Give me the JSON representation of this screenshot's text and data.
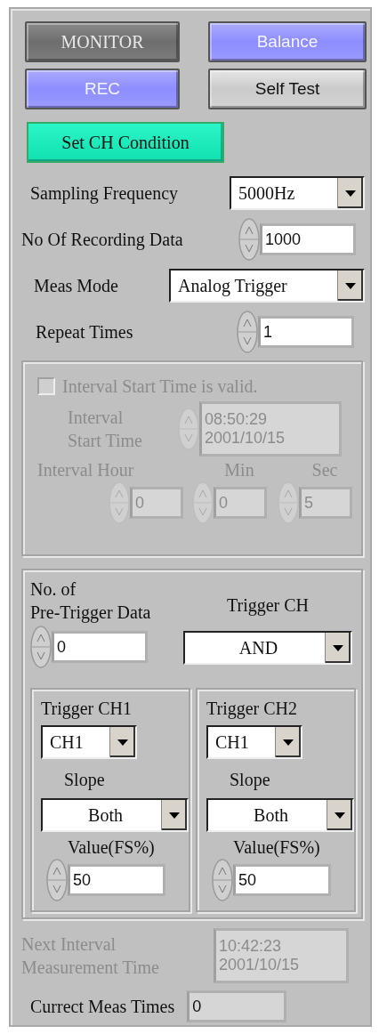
{
  "buttons": [
    {
      "label": "MONITOR",
      "kind": "dark"
    },
    {
      "label": "Balance",
      "kind": "blue"
    },
    {
      "label": "REC",
      "kind": "blue"
    },
    {
      "label": "Self Test",
      "kind": "light"
    }
  ],
  "set_ch_condition": {
    "label": "Set CH Condition"
  },
  "settings": [
    {
      "kind": "dropdown",
      "label": "Sampling Frequency",
      "value": "5000Hz"
    },
    {
      "kind": "spinner",
      "label": "No Of Recording Data",
      "value": "1000"
    },
    {
      "kind": "dropdown",
      "label": "Meas Mode",
      "value": "Analog Trigger"
    },
    {
      "kind": "spinner",
      "label": "Repeat Times",
      "value": "1"
    }
  ],
  "interval": {
    "disabled": true,
    "checkbox": {
      "label": "Interval Start Time is valid.",
      "checked": false
    },
    "start_time": {
      "label": "Interval\nStart Time",
      "value": "08:50:29\n2001/10/15"
    },
    "fields": [
      {
        "label": "Interval Hour",
        "value": "0"
      },
      {
        "label": "Min",
        "value": "0"
      },
      {
        "label": "Sec",
        "value": "5"
      }
    ]
  },
  "trigger": {
    "pre_trigger": {
      "label": "No. of\nPre-Trigger Data",
      "value": "0"
    },
    "trigger_ch": {
      "label": "Trigger CH",
      "value": "AND"
    },
    "channels": [
      {
        "title": "Trigger CH1",
        "channel": "CH1",
        "slope_label": "Slope",
        "slope": "Both",
        "value_label": "Value(FS%)",
        "value": "50"
      },
      {
        "title": "Trigger CH2",
        "channel": "CH1",
        "slope_label": "Slope",
        "slope": "Both",
        "value_label": "Value(FS%)",
        "value": "50"
      }
    ]
  },
  "next_interval": {
    "disabled": true,
    "label": "Next Interval\nMeasurement Time",
    "value": "10:42:23\n2001/10/15"
  },
  "current_meas_times": {
    "label": "Currect Meas Times",
    "value": "0"
  }
}
